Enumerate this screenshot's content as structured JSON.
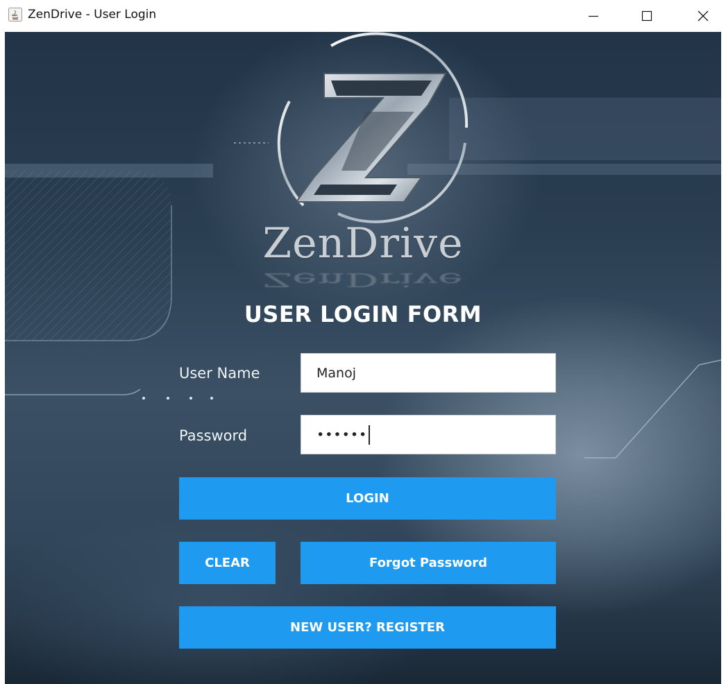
{
  "window": {
    "title": "ZenDrive - User Login",
    "controls": {
      "minimize": "minimize",
      "maximize": "maximize",
      "close": "close"
    }
  },
  "logo": {
    "letter": "Z",
    "text": "ZenDrive"
  },
  "form": {
    "heading": "USER LOGIN FORM",
    "username_label": "User Name",
    "username_value": "Manoj",
    "password_label": "Password",
    "password_value": "••••••"
  },
  "buttons": {
    "login": "LOGIN",
    "clear": "CLEAR",
    "forgot": "Forgot Password",
    "register": "NEW USER? REGISTER"
  },
  "colors": {
    "accent": "#1e9bf0",
    "background_dark": "#223447",
    "text_light": "#ffffff"
  },
  "icons": [
    "java-app-icon",
    "minimize-icon",
    "maximize-icon",
    "close-icon"
  ]
}
